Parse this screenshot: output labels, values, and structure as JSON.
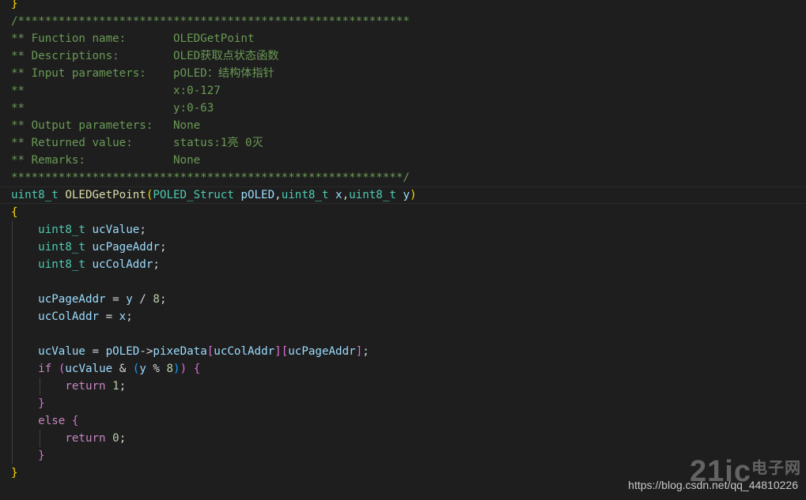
{
  "editor": {
    "lines": [
      [
        {
          "t": "}",
          "c": "tok-paren1"
        }
      ],
      [
        {
          "t": "/**********************************************************",
          "c": "tok-comment"
        }
      ],
      [
        {
          "t": "** Function name:       OLEDGetPoint",
          "c": "tok-comment"
        }
      ],
      [
        {
          "t": "** Descriptions:        OLED获取点状态函数",
          "c": "tok-comment"
        }
      ],
      [
        {
          "t": "** Input parameters:    pOLED：结构体指针",
          "c": "tok-comment"
        }
      ],
      [
        {
          "t": "**                      x:0-127",
          "c": "tok-comment"
        }
      ],
      [
        {
          "t": "**                      y:0-63",
          "c": "tok-comment"
        }
      ],
      [
        {
          "t": "** Output parameters:   None",
          "c": "tok-comment"
        }
      ],
      [
        {
          "t": "** Returned value:      status:1亮 0灭",
          "c": "tok-comment"
        }
      ],
      [
        {
          "t": "** Remarks:             None",
          "c": "tok-comment"
        }
      ],
      [
        {
          "t": "**********************************************************/",
          "c": "tok-comment"
        }
      ],
      [
        {
          "t": "uint8_t",
          "c": "tok-type"
        },
        {
          "t": " ",
          "c": "tok-plain"
        },
        {
          "t": "OLEDGetPoint",
          "c": "tok-func"
        },
        {
          "t": "(",
          "c": "tok-paren1"
        },
        {
          "t": "POLED_Struct",
          "c": "tok-type"
        },
        {
          "t": " ",
          "c": "tok-plain"
        },
        {
          "t": "pOLED",
          "c": "tok-var"
        },
        {
          "t": ",",
          "c": "tok-plain"
        },
        {
          "t": "uint8_t",
          "c": "tok-type"
        },
        {
          "t": " ",
          "c": "tok-plain"
        },
        {
          "t": "x",
          "c": "tok-var"
        },
        {
          "t": ",",
          "c": "tok-plain"
        },
        {
          "t": "uint8_t",
          "c": "tok-type"
        },
        {
          "t": " ",
          "c": "tok-plain"
        },
        {
          "t": "y",
          "c": "tok-var"
        },
        {
          "t": ")",
          "c": "tok-paren1"
        }
      ],
      [
        {
          "t": "{",
          "c": "tok-paren1"
        }
      ],
      [
        {
          "t": "    ",
          "c": "tok-plain"
        },
        {
          "t": "uint8_t",
          "c": "tok-type"
        },
        {
          "t": " ",
          "c": "tok-plain"
        },
        {
          "t": "ucValue",
          "c": "tok-var"
        },
        {
          "t": ";",
          "c": "tok-plain"
        }
      ],
      [
        {
          "t": "    ",
          "c": "tok-plain"
        },
        {
          "t": "uint8_t",
          "c": "tok-type"
        },
        {
          "t": " ",
          "c": "tok-plain"
        },
        {
          "t": "ucPageAddr",
          "c": "tok-var"
        },
        {
          "t": ";",
          "c": "tok-plain"
        }
      ],
      [
        {
          "t": "    ",
          "c": "tok-plain"
        },
        {
          "t": "uint8_t",
          "c": "tok-type"
        },
        {
          "t": " ",
          "c": "tok-plain"
        },
        {
          "t": "ucColAddr",
          "c": "tok-var"
        },
        {
          "t": ";",
          "c": "tok-plain"
        }
      ],
      [],
      [
        {
          "t": "    ",
          "c": "tok-plain"
        },
        {
          "t": "ucPageAddr",
          "c": "tok-var"
        },
        {
          "t": " = ",
          "c": "tok-plain"
        },
        {
          "t": "y",
          "c": "tok-var"
        },
        {
          "t": " / ",
          "c": "tok-plain"
        },
        {
          "t": "8",
          "c": "tok-num"
        },
        {
          "t": ";",
          "c": "tok-plain"
        }
      ],
      [
        {
          "t": "    ",
          "c": "tok-plain"
        },
        {
          "t": "ucColAddr",
          "c": "tok-var"
        },
        {
          "t": " = ",
          "c": "tok-plain"
        },
        {
          "t": "x",
          "c": "tok-var"
        },
        {
          "t": ";",
          "c": "tok-plain"
        }
      ],
      [],
      [
        {
          "t": "    ",
          "c": "tok-plain"
        },
        {
          "t": "ucValue",
          "c": "tok-var"
        },
        {
          "t": " = ",
          "c": "tok-plain"
        },
        {
          "t": "pOLED",
          "c": "tok-var"
        },
        {
          "t": "->",
          "c": "tok-plain"
        },
        {
          "t": "pixeData",
          "c": "tok-var"
        },
        {
          "t": "[",
          "c": "tok-paren2"
        },
        {
          "t": "ucColAddr",
          "c": "tok-var"
        },
        {
          "t": "]",
          "c": "tok-paren2"
        },
        {
          "t": "[",
          "c": "tok-paren2"
        },
        {
          "t": "ucPageAddr",
          "c": "tok-var"
        },
        {
          "t": "]",
          "c": "tok-paren2"
        },
        {
          "t": ";",
          "c": "tok-plain"
        }
      ],
      [
        {
          "t": "    ",
          "c": "tok-plain"
        },
        {
          "t": "if",
          "c": "tok-kw"
        },
        {
          "t": " ",
          "c": "tok-plain"
        },
        {
          "t": "(",
          "c": "tok-paren2"
        },
        {
          "t": "ucValue",
          "c": "tok-var"
        },
        {
          "t": " & ",
          "c": "tok-plain"
        },
        {
          "t": "(",
          "c": "tok-paren3"
        },
        {
          "t": "y",
          "c": "tok-var"
        },
        {
          "t": " % ",
          "c": "tok-plain"
        },
        {
          "t": "8",
          "c": "tok-num"
        },
        {
          "t": ")",
          "c": "tok-paren3"
        },
        {
          "t": ")",
          "c": "tok-paren2"
        },
        {
          "t": " ",
          "c": "tok-plain"
        },
        {
          "t": "{",
          "c": "tok-paren2"
        }
      ],
      [
        {
          "t": "        ",
          "c": "tok-plain"
        },
        {
          "t": "return",
          "c": "tok-kw"
        },
        {
          "t": " ",
          "c": "tok-plain"
        },
        {
          "t": "1",
          "c": "tok-num"
        },
        {
          "t": ";",
          "c": "tok-plain"
        }
      ],
      [
        {
          "t": "    ",
          "c": "tok-plain"
        },
        {
          "t": "}",
          "c": "tok-paren2"
        }
      ],
      [
        {
          "t": "    ",
          "c": "tok-plain"
        },
        {
          "t": "else",
          "c": "tok-kw"
        },
        {
          "t": " ",
          "c": "tok-plain"
        },
        {
          "t": "{",
          "c": "tok-paren2"
        }
      ],
      [
        {
          "t": "        ",
          "c": "tok-plain"
        },
        {
          "t": "return",
          "c": "tok-kw"
        },
        {
          "t": " ",
          "c": "tok-plain"
        },
        {
          "t": "0",
          "c": "tok-num"
        },
        {
          "t": ";",
          "c": "tok-plain"
        }
      ],
      [
        {
          "t": "    ",
          "c": "tok-plain"
        },
        {
          "t": "}",
          "c": "tok-paren2"
        }
      ],
      [
        {
          "t": "}",
          "c": "tok-paren1"
        }
      ]
    ]
  },
  "watermark": {
    "url": "https://blog.csdn.net/qq_44810226",
    "logo_main": "21ic",
    "logo_sub": "电子网"
  },
  "colors": {
    "background": "#1e1e1e",
    "comment": "#6a9955",
    "type": "#4ec9b0",
    "function": "#dcdcaa",
    "variable": "#9cdcfe",
    "keyword": "#c586c0",
    "number": "#b5cea8"
  }
}
